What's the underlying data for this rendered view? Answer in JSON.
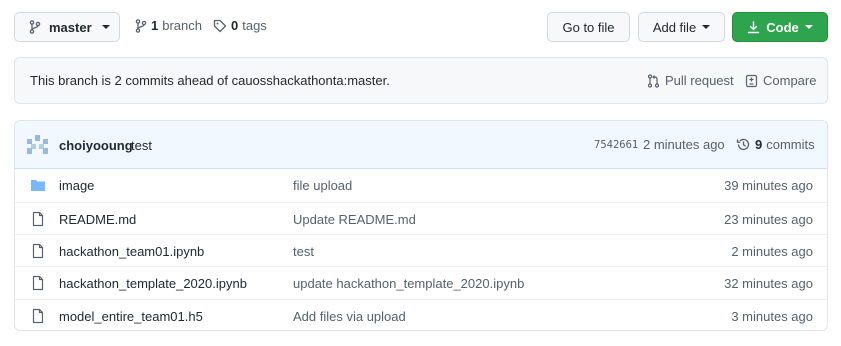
{
  "toolbar": {
    "branch": "master",
    "branch_count": "1",
    "branch_word": "branch",
    "tag_count": "0",
    "tag_word": "tags",
    "goto_file": "Go to file",
    "add_file": "Add file",
    "code": "Code"
  },
  "banner": {
    "text": "This branch is 2 commits ahead of cauosshackathonta:master.",
    "pull_request": "Pull request",
    "compare": "Compare"
  },
  "commit": {
    "author": "choiyooung",
    "message": "test",
    "sha": "7542661",
    "time": "2 minutes ago",
    "count": "9",
    "count_word": "commits"
  },
  "files": [
    {
      "type": "dir",
      "icon": "folder-icon",
      "name": "image",
      "message": "file upload",
      "age": "39 minutes ago"
    },
    {
      "type": "file",
      "icon": "file-icon",
      "name": "README.md",
      "message": "Update README.md",
      "age": "23 minutes ago"
    },
    {
      "type": "file",
      "icon": "file-icon",
      "name": "hackathon_team01.ipynb",
      "message": "test",
      "age": "2 minutes ago"
    },
    {
      "type": "file",
      "icon": "file-icon",
      "name": "hackathon_template_2020.ipynb",
      "message": "update hackathon_template_2020.ipynb",
      "age": "32 minutes ago"
    },
    {
      "type": "file",
      "icon": "file-icon",
      "name": "model_entire_team01.h5",
      "message": "Add files via upload",
      "age": "3 minutes ago"
    }
  ],
  "colors": {
    "accent_green": "#2ea44f",
    "folder_blue": "#79b8ff",
    "commit_header_bg": "#f1f8ff"
  }
}
